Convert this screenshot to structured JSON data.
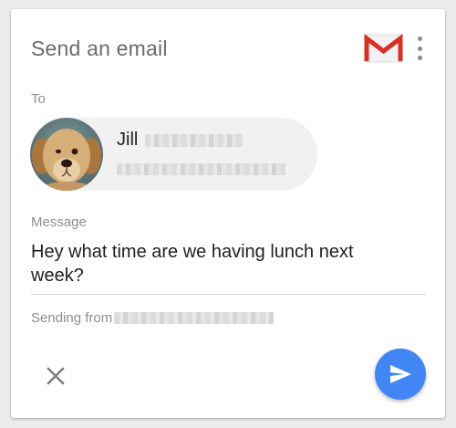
{
  "card": {
    "title": "Send an email",
    "brand_icon": "gmail-logo",
    "menu_icon": "more-vert-icon"
  },
  "to": {
    "label": "To",
    "contact": {
      "name": "Jill",
      "avatar": "dog-photo"
    }
  },
  "message": {
    "label": "Message",
    "body": "Hey what time are we having lunch next week?"
  },
  "sending": {
    "label": "Sending from"
  },
  "actions": {
    "close_icon": "close-icon",
    "send_icon": "send-icon"
  },
  "colors": {
    "accent": "#4285f4",
    "gmail_red": "#d93025",
    "label_gray": "#8d8d8d",
    "title_gray": "#6b6b6b"
  }
}
